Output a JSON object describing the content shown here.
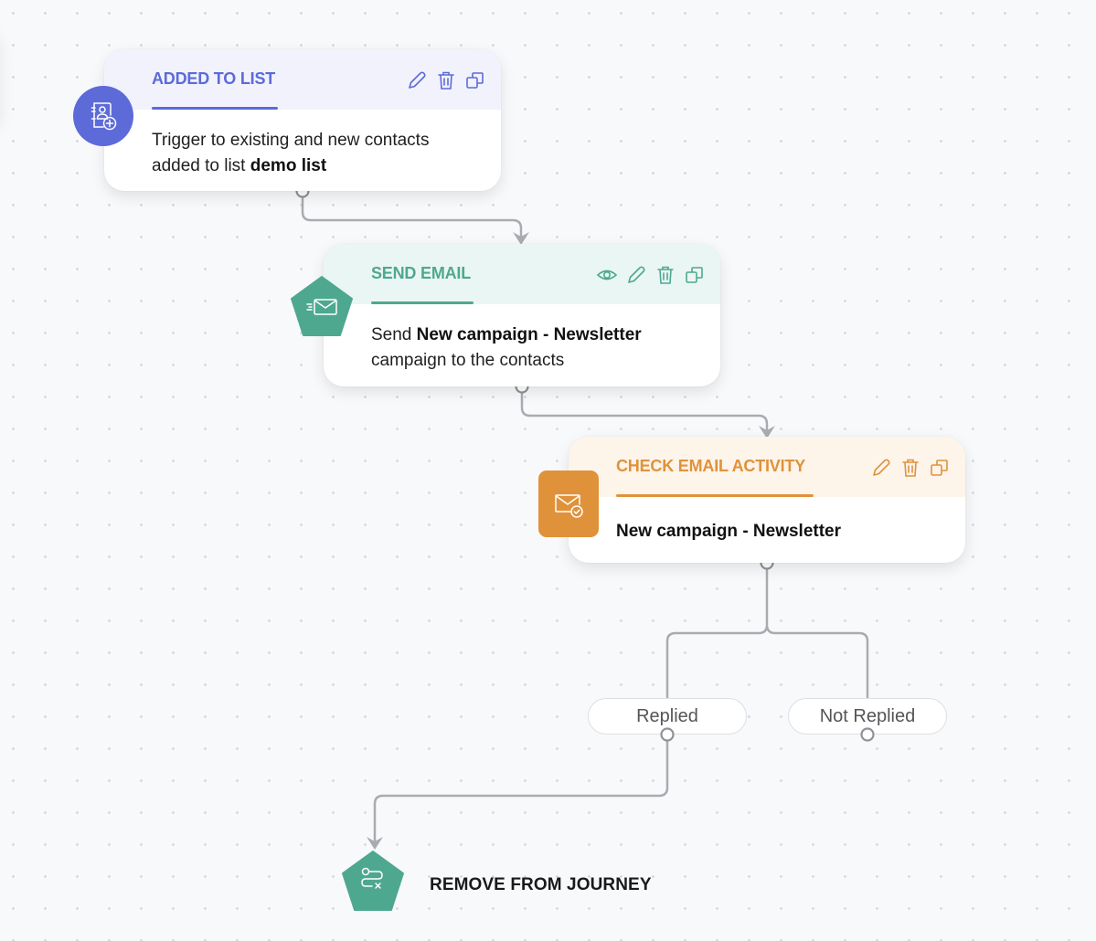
{
  "colors": {
    "trigger": "#5c6bd8",
    "send_email": "#4ea88f",
    "check_activity": "#e0923a",
    "exit": "#4ea88f",
    "connector": "#a9abb0"
  },
  "nodes": {
    "added_to_list": {
      "title": "ADDED TO LIST",
      "icon": "list-add-contact-icon",
      "description_prefix": "Trigger to existing and new contacts added to list ",
      "description_bold": "demo list",
      "actions": [
        "edit-icon",
        "delete-icon",
        "duplicate-icon"
      ]
    },
    "send_email": {
      "title": "SEND EMAIL",
      "icon": "send-email-icon",
      "description_prefix": "Send ",
      "description_bold": "New campaign - Newsletter",
      "description_suffix": " campaign to the contacts",
      "actions": [
        "preview-eye-icon",
        "edit-icon",
        "delete-icon",
        "duplicate-icon"
      ]
    },
    "check_email_activity": {
      "title": "CHECK EMAIL ACTIVITY",
      "icon": "email-check-icon",
      "description_bold": "New campaign - Newsletter",
      "actions": [
        "edit-icon",
        "delete-icon",
        "duplicate-icon"
      ]
    },
    "branches": {
      "replied": "Replied",
      "not_replied": "Not Replied"
    },
    "remove_from_journey": {
      "title": "REMOVE FROM JOURNEY",
      "icon": "exit-journey-icon"
    }
  }
}
